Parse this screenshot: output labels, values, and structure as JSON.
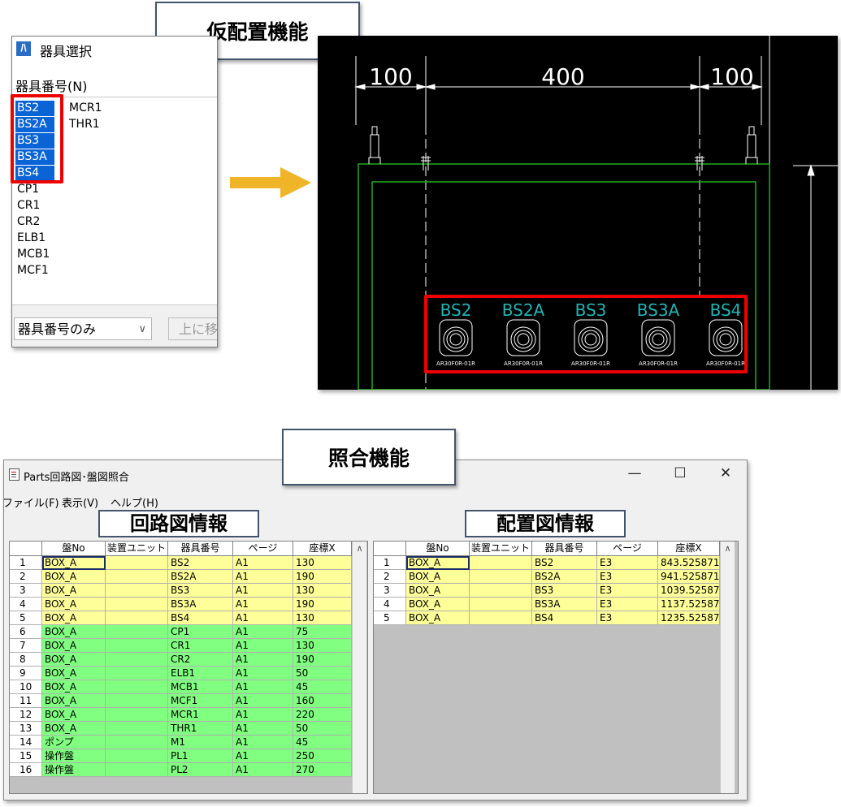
{
  "top_callout": "仮配置機能",
  "bottom_callout": "照合機能",
  "selector": {
    "title": "器具選択",
    "field_label": "器具番号(N)",
    "column1": [
      "BS2",
      "BS2A",
      "BS3",
      "BS3A",
      "BS4",
      "CP1",
      "CR1",
      "CR2",
      "ELB1",
      "MCB1",
      "MCF1"
    ],
    "column1_selected": 5,
    "column2": [
      "MCR1",
      "THR1"
    ],
    "filter_value": "器具番号のみ",
    "move_up_button": "上に移"
  },
  "cad": {
    "dimensions": [
      "100",
      "400",
      "100"
    ],
    "parts": [
      {
        "label": "BS2",
        "part": "AR30F0R-01R"
      },
      {
        "label": "BS2A",
        "part": "AR30F0R-01R"
      },
      {
        "label": "BS3",
        "part": "AR30F0R-01R"
      },
      {
        "label": "BS3A",
        "part": "AR30F0R-01R"
      },
      {
        "label": "BS4",
        "part": "AR30F0R-01R"
      }
    ],
    "colors": {
      "background": "#000000",
      "frame": "#22aa22",
      "label": "#22b4b4",
      "lines": "#ffffff"
    }
  },
  "window": {
    "title": "Parts回路図･盤図照合",
    "controls": {
      "minimize": "—",
      "maximize": "☐",
      "close": "✕"
    },
    "menu": [
      "ファイル(F)",
      "表示(V)",
      "ヘルプ(H)"
    ],
    "left_label": "回路図情報",
    "right_label": "配置図情報",
    "columns": [
      "盤No",
      "装置ユニット",
      "器具番号",
      "ページ",
      "座標X"
    ],
    "left_rows": [
      {
        "n": "1",
        "ban": "BOX_A",
        "unit": "",
        "id": "BS2",
        "page": "A1",
        "x": "130",
        "status": "matched"
      },
      {
        "n": "2",
        "ban": "BOX_A",
        "unit": "",
        "id": "BS2A",
        "page": "A1",
        "x": "190",
        "status": "matched"
      },
      {
        "n": "3",
        "ban": "BOX_A",
        "unit": "",
        "id": "BS3",
        "page": "A1",
        "x": "130",
        "status": "matched"
      },
      {
        "n": "4",
        "ban": "BOX_A",
        "unit": "",
        "id": "BS3A",
        "page": "A1",
        "x": "190",
        "status": "matched"
      },
      {
        "n": "5",
        "ban": "BOX_A",
        "unit": "",
        "id": "BS4",
        "page": "A1",
        "x": "130",
        "status": "matched"
      },
      {
        "n": "6",
        "ban": "BOX_A",
        "unit": "",
        "id": "CP1",
        "page": "A1",
        "x": "75",
        "status": "unplaced"
      },
      {
        "n": "7",
        "ban": "BOX_A",
        "unit": "",
        "id": "CR1",
        "page": "A1",
        "x": "130",
        "status": "unplaced"
      },
      {
        "n": "8",
        "ban": "BOX_A",
        "unit": "",
        "id": "CR2",
        "page": "A1",
        "x": "190",
        "status": "unplaced"
      },
      {
        "n": "9",
        "ban": "BOX_A",
        "unit": "",
        "id": "ELB1",
        "page": "A1",
        "x": "50",
        "status": "unplaced"
      },
      {
        "n": "10",
        "ban": "BOX_A",
        "unit": "",
        "id": "MCB1",
        "page": "A1",
        "x": "45",
        "status": "unplaced"
      },
      {
        "n": "11",
        "ban": "BOX_A",
        "unit": "",
        "id": "MCF1",
        "page": "A1",
        "x": "160",
        "status": "unplaced"
      },
      {
        "n": "12",
        "ban": "BOX_A",
        "unit": "",
        "id": "MCR1",
        "page": "A1",
        "x": "220",
        "status": "unplaced"
      },
      {
        "n": "13",
        "ban": "BOX_A",
        "unit": "",
        "id": "THR1",
        "page": "A1",
        "x": "50",
        "status": "unplaced"
      },
      {
        "n": "14",
        "ban": "ポンプ",
        "unit": "",
        "id": "M1",
        "page": "A1",
        "x": "45",
        "status": "unplaced"
      },
      {
        "n": "15",
        "ban": "操作盤",
        "unit": "",
        "id": "PL1",
        "page": "A1",
        "x": "250",
        "status": "unplaced"
      },
      {
        "n": "16",
        "ban": "操作盤",
        "unit": "",
        "id": "PL2",
        "page": "A1",
        "x": "270",
        "status": "unplaced"
      }
    ],
    "right_rows": [
      {
        "n": "1",
        "ban": "BOX_A",
        "unit": "",
        "id": "BS2",
        "page": "E3",
        "x": "843.525871",
        "status": "matched"
      },
      {
        "n": "2",
        "ban": "BOX_A",
        "unit": "",
        "id": "BS2A",
        "page": "E3",
        "x": "941.525871",
        "status": "matched"
      },
      {
        "n": "3",
        "ban": "BOX_A",
        "unit": "",
        "id": "BS3",
        "page": "E3",
        "x": "1039.525871",
        "status": "matched"
      },
      {
        "n": "4",
        "ban": "BOX_A",
        "unit": "",
        "id": "BS3A",
        "page": "E3",
        "x": "1137.525871",
        "status": "matched"
      },
      {
        "n": "5",
        "ban": "BOX_A",
        "unit": "",
        "id": "BS4",
        "page": "E3",
        "x": "1235.525871",
        "status": "matched"
      }
    ],
    "row_colors": {
      "matched": "#ffff99",
      "unplaced": "#80ff80"
    }
  }
}
